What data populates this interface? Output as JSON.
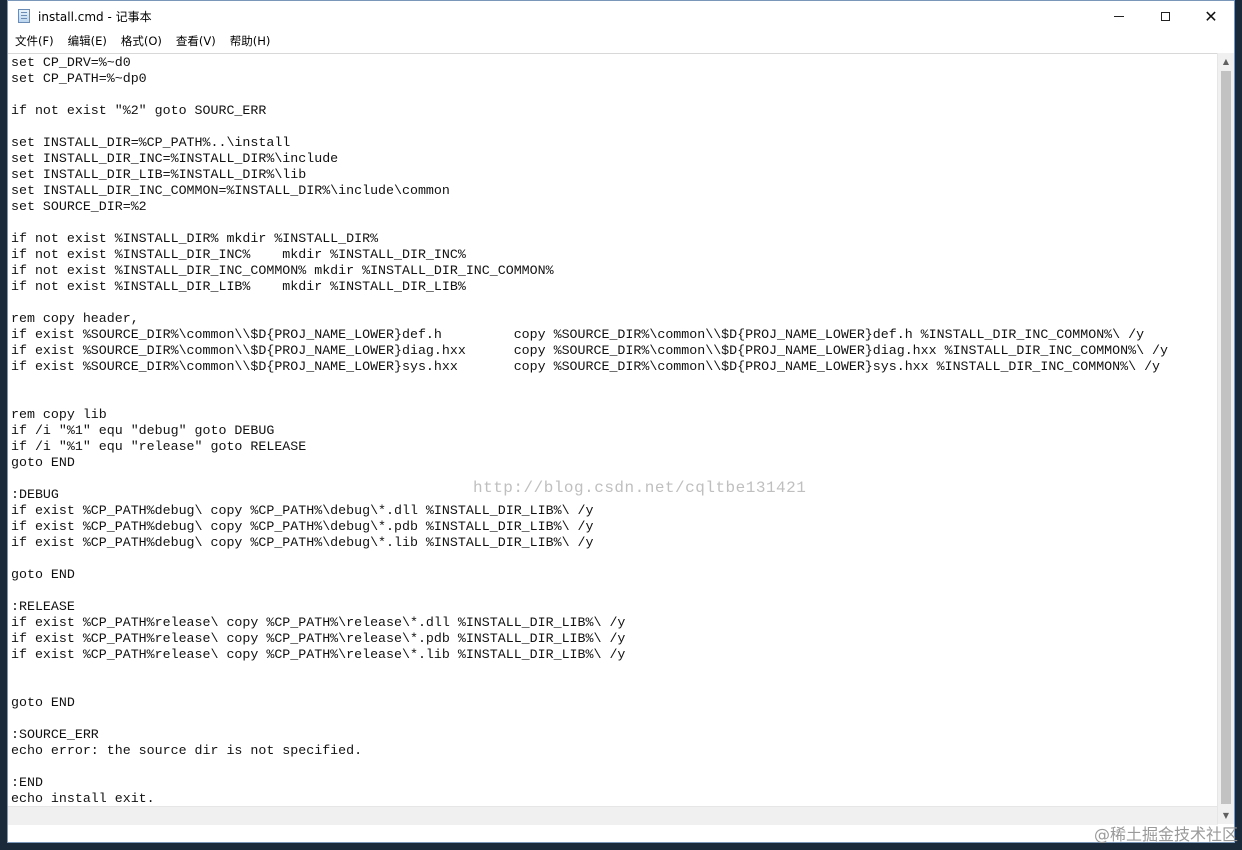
{
  "window": {
    "title": "install.cmd - 记事本",
    "minimize_glyph": "—",
    "maximize_glyph": "☐",
    "close_glyph": "✕"
  },
  "menu": {
    "file": "文件(F)",
    "edit": "编辑(E)",
    "format": "格式(O)",
    "view": "查看(V)",
    "help": "帮助(H)"
  },
  "editor": {
    "content": "set CP_DRV=%~d0\nset CP_PATH=%~dp0\n\nif not exist \"%2\" goto SOURC_ERR\n\nset INSTALL_DIR=%CP_PATH%..\\install\nset INSTALL_DIR_INC=%INSTALL_DIR%\\include\nset INSTALL_DIR_LIB=%INSTALL_DIR%\\lib\nset INSTALL_DIR_INC_COMMON=%INSTALL_DIR%\\include\\common\nset SOURCE_DIR=%2\n\nif not exist %INSTALL_DIR% mkdir %INSTALL_DIR%\nif not exist %INSTALL_DIR_INC%    mkdir %INSTALL_DIR_INC%\nif not exist %INSTALL_DIR_INC_COMMON% mkdir %INSTALL_DIR_INC_COMMON%\nif not exist %INSTALL_DIR_LIB%    mkdir %INSTALL_DIR_LIB%\n\nrem copy header,\nif exist %SOURCE_DIR%\\common\\\\$D{PROJ_NAME_LOWER}def.h         copy %SOURCE_DIR%\\common\\\\$D{PROJ_NAME_LOWER}def.h %INSTALL_DIR_INC_COMMON%\\ /y\nif exist %SOURCE_DIR%\\common\\\\$D{PROJ_NAME_LOWER}diag.hxx      copy %SOURCE_DIR%\\common\\\\$D{PROJ_NAME_LOWER}diag.hxx %INSTALL_DIR_INC_COMMON%\\ /y\nif exist %SOURCE_DIR%\\common\\\\$D{PROJ_NAME_LOWER}sys.hxx       copy %SOURCE_DIR%\\common\\\\$D{PROJ_NAME_LOWER}sys.hxx %INSTALL_DIR_INC_COMMON%\\ /y\n\n\nrem copy lib\nif /i \"%1\" equ \"debug\" goto DEBUG\nif /i \"%1\" equ \"release\" goto RELEASE\ngoto END\n\n:DEBUG\nif exist %CP_PATH%debug\\ copy %CP_PATH%\\debug\\*.dll %INSTALL_DIR_LIB%\\ /y\nif exist %CP_PATH%debug\\ copy %CP_PATH%\\debug\\*.pdb %INSTALL_DIR_LIB%\\ /y\nif exist %CP_PATH%debug\\ copy %CP_PATH%\\debug\\*.lib %INSTALL_DIR_LIB%\\ /y\n\ngoto END\n\n:RELEASE\nif exist %CP_PATH%release\\ copy %CP_PATH%\\release\\*.dll %INSTALL_DIR_LIB%\\ /y\nif exist %CP_PATH%release\\ copy %CP_PATH%\\release\\*.pdb %INSTALL_DIR_LIB%\\ /y\nif exist %CP_PATH%release\\ copy %CP_PATH%\\release\\*.lib %INSTALL_DIR_LIB%\\ /y\n\n\ngoto END\n\n:SOURCE_ERR\necho error: the source dir is not specified.\n\n:END\necho install exit."
  },
  "watermarks": {
    "center": "http://blog.csdn.net/cqltbe131421",
    "corner": "@稀土掘金技术社区"
  },
  "scrollbar": {
    "up_arrow": "▲",
    "down_arrow": "▼"
  }
}
